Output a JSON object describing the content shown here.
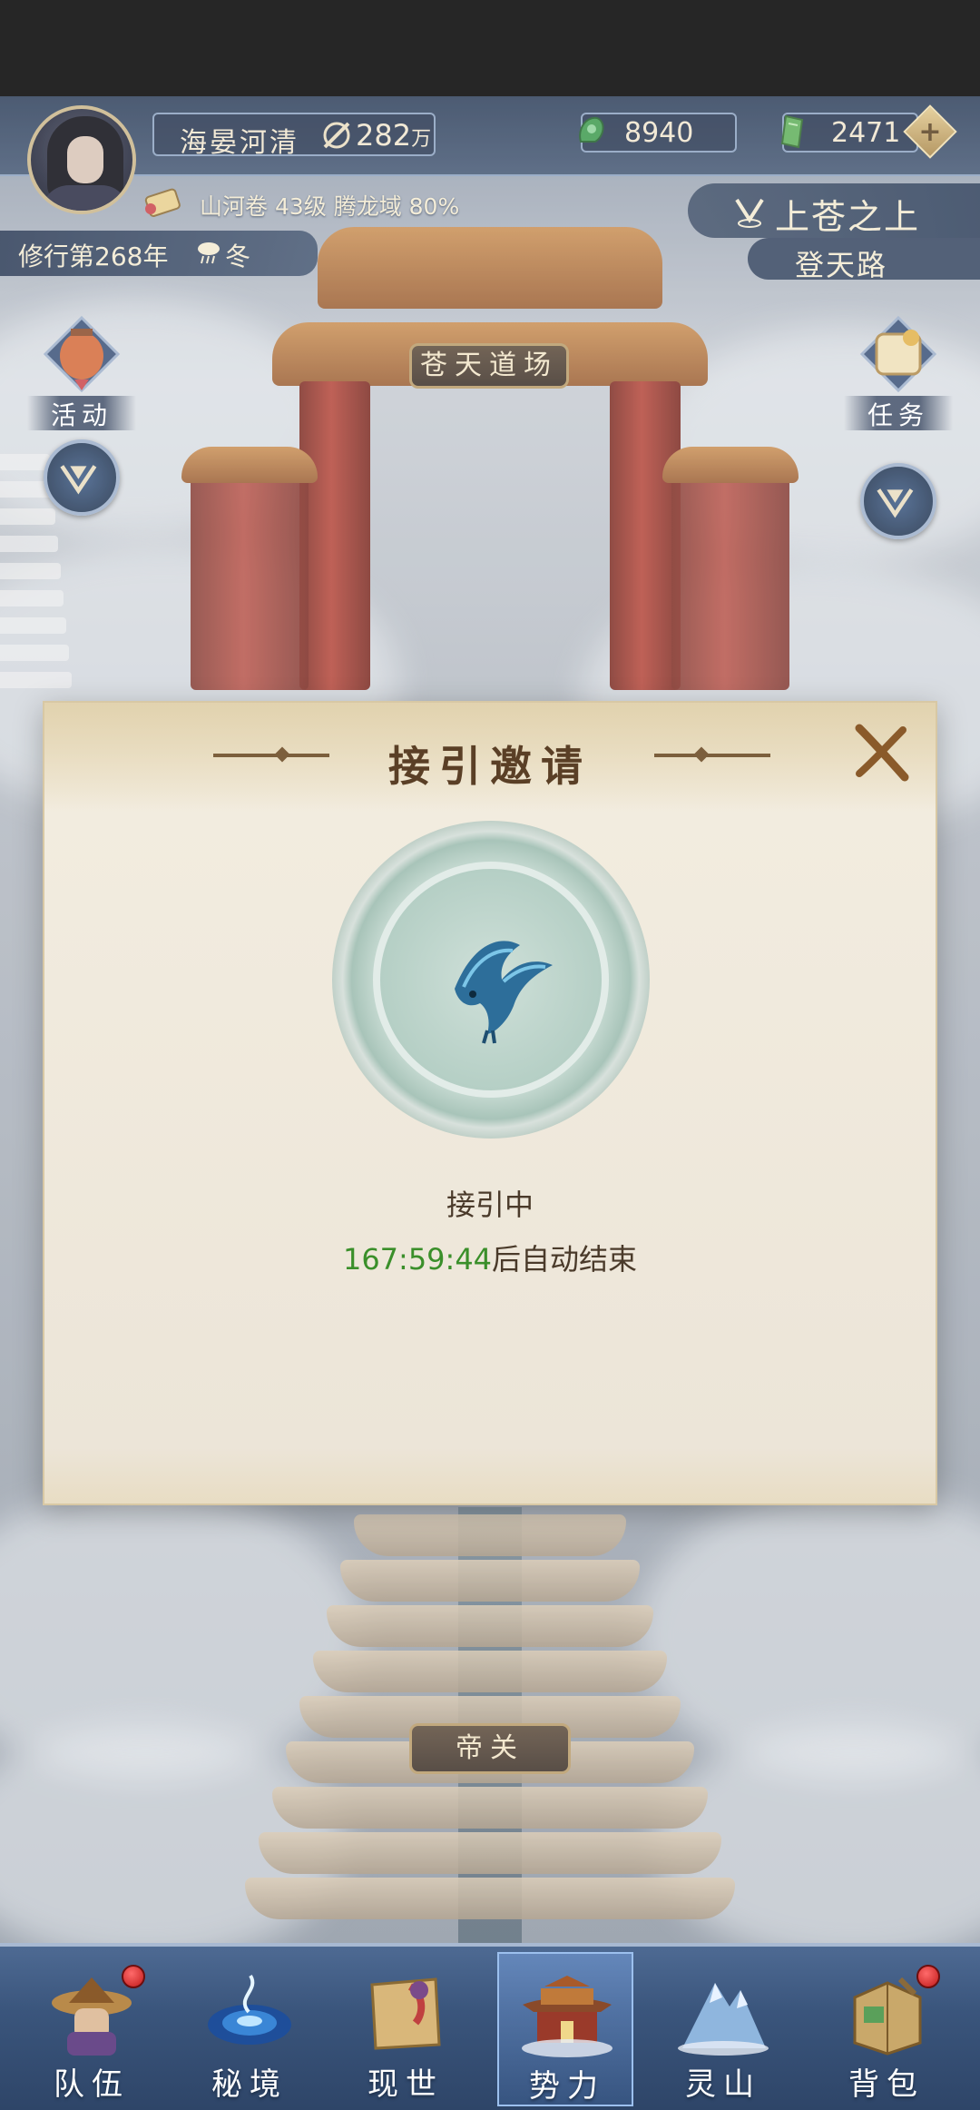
{
  "player": {
    "name": "海晏河清",
    "power": "282",
    "power_unit": "万"
  },
  "currencies": [
    {
      "name": "jade",
      "value": "8940"
    },
    {
      "name": "spirit-stone",
      "value": "2471"
    }
  ],
  "progress": {
    "text": "山河卷 43级 腾龙域 80%"
  },
  "year": {
    "label": "修行第268年",
    "season": "冬"
  },
  "location": {
    "region": "上苍之上",
    "route": "登天路"
  },
  "side_buttons": {
    "activity": "活动",
    "quest": "任务"
  },
  "place_labels": {
    "top": "苍天道场",
    "bottom": "帝关"
  },
  "modal": {
    "title": "接引邀请",
    "status": "接引中",
    "timer": "167:59:44",
    "timer_suffix": "后自动结束"
  },
  "bottom_nav": [
    {
      "label": "队伍",
      "badge": true,
      "active": false
    },
    {
      "label": "秘境",
      "badge": false,
      "active": false
    },
    {
      "label": "现世",
      "badge": false,
      "active": false
    },
    {
      "label": "势力",
      "badge": false,
      "active": true
    },
    {
      "label": "灵山",
      "badge": false,
      "active": false
    },
    {
      "label": "背包",
      "badge": true,
      "active": false
    }
  ],
  "colors": {
    "hud": "#2f4568",
    "accent_gold": "#c9b68a",
    "timer_green": "#3a8f2a",
    "modal_bg": "#ece5d8"
  }
}
